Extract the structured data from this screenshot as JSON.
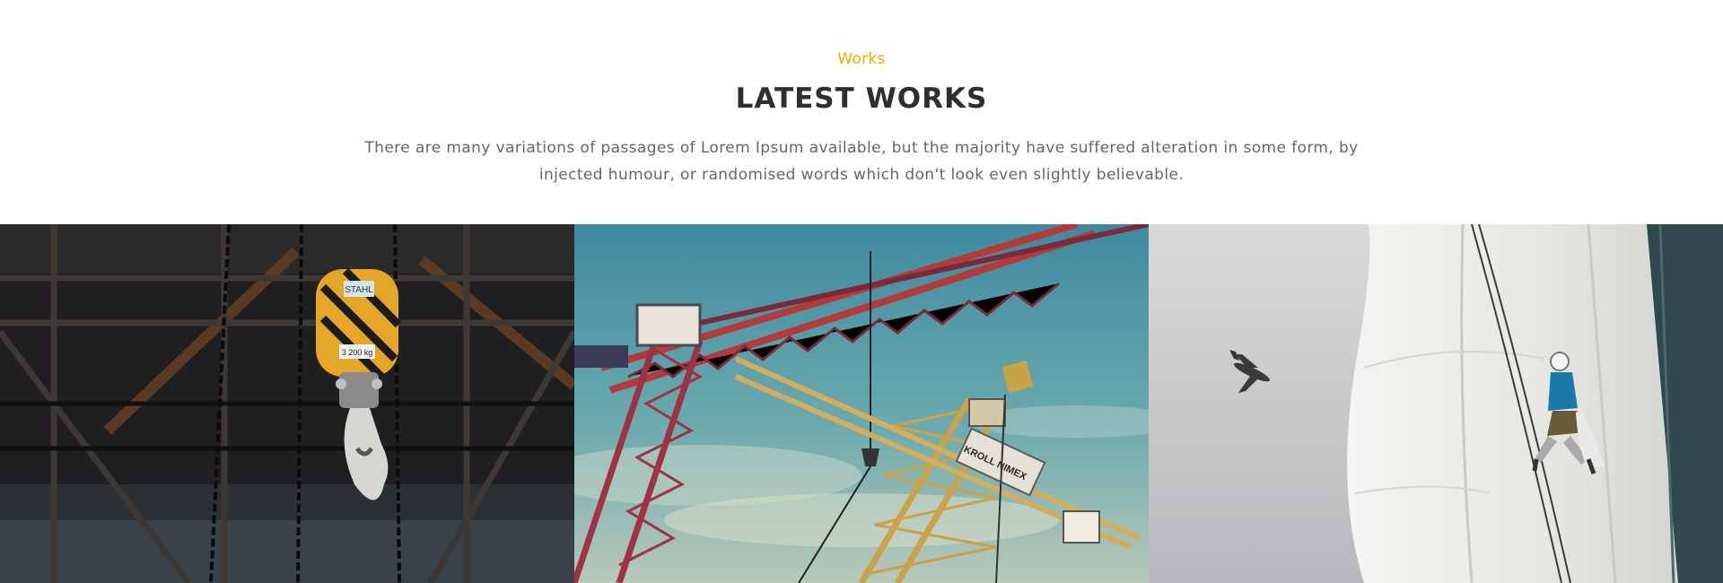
{
  "works_section": {
    "eyebrow": "Works",
    "title": "LATEST WORKS",
    "description": "There are many variations of passages of Lorem Ipsum available, but the majority have suffered alteration in some form, by injected humour, or randomised words which don't look even slightly believable."
  },
  "colors": {
    "accent": "#f0a800",
    "title": "#2f2f2f",
    "text": "#666666"
  },
  "gallery": {
    "items": [
      {
        "icon": "crane-hook-photo",
        "hook_brand": "STAHL",
        "hook_capacity": "3 200 kg"
      },
      {
        "icon": "tower-cranes-photo",
        "crane_text": "KROLL NIMEX"
      },
      {
        "icon": "building-climber-photo"
      }
    ]
  }
}
